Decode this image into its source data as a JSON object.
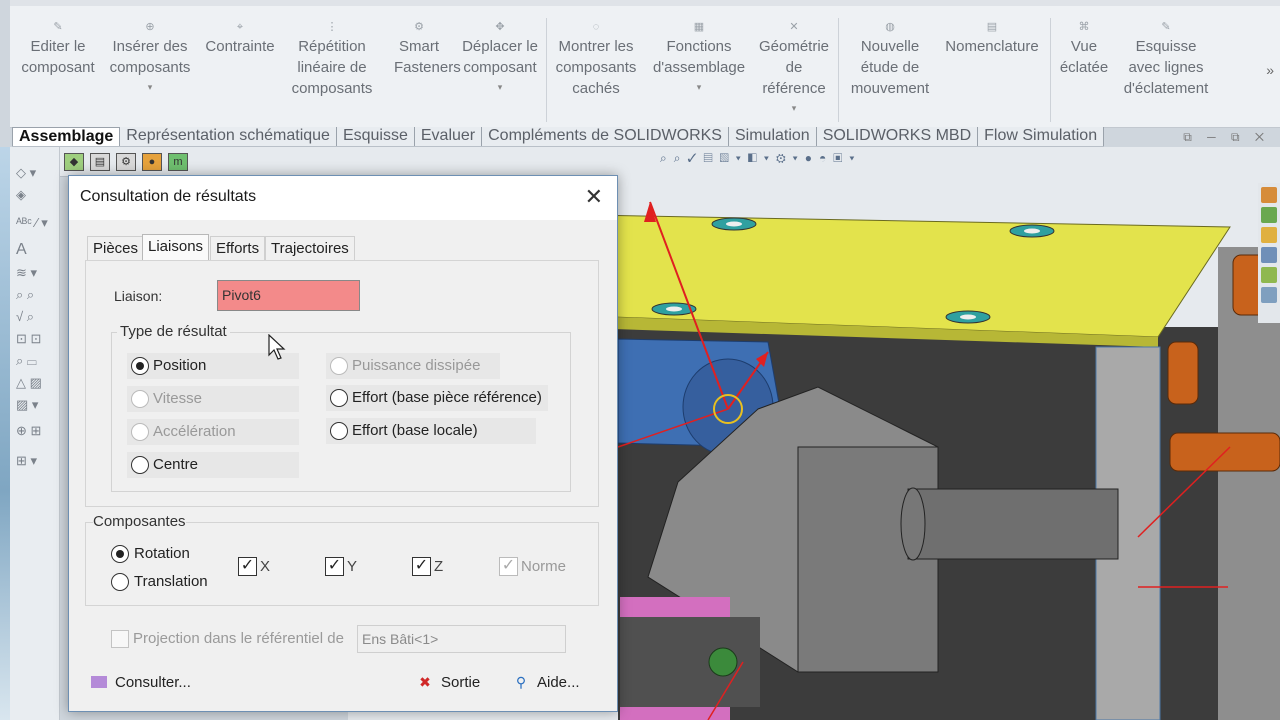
{
  "ribbon": {
    "buttons": [
      {
        "label": "Editer le\ncomposant",
        "icon": "edit-component-icon",
        "dropdown": false
      },
      {
        "label": "Insérer des\ncomposants",
        "icon": "insert-components-icon",
        "dropdown": true
      },
      {
        "label": "Contrainte",
        "icon": "mate-icon",
        "dropdown": false
      },
      {
        "label": "Répétition\nlinéaire de\ncomposants",
        "icon": "linear-pattern-icon",
        "dropdown": false
      },
      {
        "label": "Smart\nFasteners",
        "icon": "smart-fasteners-icon",
        "dropdown": false
      },
      {
        "label": "Déplacer le\ncomposant",
        "icon": "move-component-icon",
        "dropdown": true
      },
      {
        "label": "Montrer les\ncomposants\ncachés",
        "icon": "show-hidden-icon",
        "dropdown": false
      },
      {
        "label": "Fonctions\nd'assemblage",
        "icon": "assembly-features-icon",
        "dropdown": true
      },
      {
        "label": "Géométrie\nde\nréférence",
        "icon": "reference-geometry-icon",
        "dropdown": true
      },
      {
        "label": "Nouvelle\nétude de\nmouvement",
        "icon": "motion-study-icon",
        "dropdown": false
      },
      {
        "label": "Nomenclature",
        "icon": "bom-icon",
        "dropdown": false
      },
      {
        "label": "Vue\néclatée",
        "icon": "exploded-view-icon",
        "dropdown": false
      },
      {
        "label": "Esquisse\navec lignes\nd'éclatement",
        "icon": "explode-line-sketch-icon",
        "dropdown": false
      }
    ],
    "more": "»"
  },
  "tabs": [
    "Assemblage",
    "Représentation schématique",
    "Esquisse",
    "Evaluer",
    "Compléments de SOLIDWORKS",
    "Simulation",
    "SOLIDWORKS MBD",
    "Flow Simulation"
  ],
  "dialog": {
    "title": "Consultation de résultats",
    "close": "✕",
    "tabs": [
      "Pièces",
      "Liaisons",
      "Efforts",
      "Trajectoires"
    ],
    "active_tab": "Liaisons",
    "liaison_label": "Liaison:",
    "liaison_value": "Pivot6",
    "type_group_title": "Type de résultat",
    "type_options_left": [
      {
        "label": "Position",
        "enabled": true,
        "selected": true
      },
      {
        "label": "Vitesse",
        "enabled": false,
        "selected": false
      },
      {
        "label": "Accélération",
        "enabled": false,
        "selected": false
      },
      {
        "label": "Centre",
        "enabled": true,
        "selected": false
      }
    ],
    "type_options_right": [
      {
        "label": "Puissance dissipée",
        "enabled": false,
        "selected": false
      },
      {
        "label": "Effort (base pièce référence)",
        "enabled": true,
        "selected": false
      },
      {
        "label": "Effort (base locale)",
        "enabled": true,
        "selected": false
      }
    ],
    "components_title": "Composantes",
    "rotation_label": "Rotation",
    "translation_label": "Translation",
    "checks": [
      {
        "label": "X",
        "checked": true,
        "enabled": true
      },
      {
        "label": "Y",
        "checked": true,
        "enabled": true
      },
      {
        "label": "Z",
        "checked": true,
        "enabled": true
      },
      {
        "label": "Norme",
        "checked": true,
        "enabled": false
      }
    ],
    "projection_label": "Projection dans le référentiel de",
    "projection_value": "Ens Bâti<1>",
    "consult_label": "Consulter...",
    "exit_label": "Sortie",
    "help_label": "Aide..."
  },
  "colors": {
    "liaison_field": "#f38a8a",
    "plate_yellow": "#e4e44e",
    "part_blue": "#3e6fb3",
    "bushing_orange": "#c8621c",
    "arrow_red": "#e02020"
  }
}
